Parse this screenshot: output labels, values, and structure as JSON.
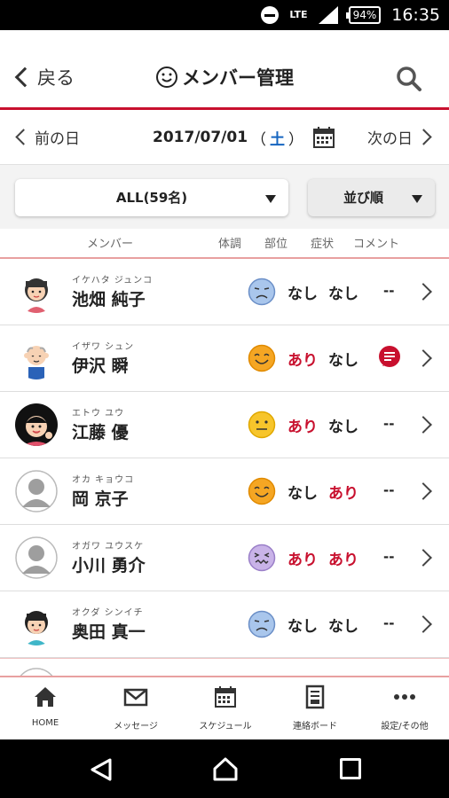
{
  "status_bar": {
    "network": "LTE",
    "battery": "94%",
    "time": "16:35"
  },
  "header": {
    "back_label": "戻る",
    "title": "メンバー管理",
    "title_icon": "smiley-icon",
    "search_icon": "search-icon"
  },
  "date_nav": {
    "prev_label": "前の日",
    "date": "2017/07/01",
    "open_paren": "（",
    "day_of_week": "土",
    "close_paren": "）",
    "next_label": "次の日"
  },
  "filters": {
    "group_selected": "ALL(59名)",
    "sort_label": "並び順"
  },
  "columns": {
    "member": "メンバー",
    "condition": "体調",
    "body_part": "部位",
    "symptom": "症状",
    "comment": "コメント"
  },
  "members": [
    {
      "kana": "イケハタ ジュンコ",
      "name": "池畑 純子",
      "condition_face": "sad-face",
      "body_part": "なし",
      "symptom": "なし",
      "comment": "--"
    },
    {
      "kana": "イザワ シュン",
      "name": "伊沢 瞬",
      "condition_face": "happy-face",
      "body_part": "あり",
      "symptom": "なし",
      "comment": "chat-icon"
    },
    {
      "kana": "エトウ ユウ",
      "name": "江藤 優",
      "condition_face": "neutral-face",
      "body_part": "あり",
      "symptom": "なし",
      "comment": "--"
    },
    {
      "kana": "オカ キョウコ",
      "name": "岡 京子",
      "condition_face": "happy-face",
      "body_part": "なし",
      "symptom": "あり",
      "comment": "--"
    },
    {
      "kana": "オガワ ユウスケ",
      "name": "小川 勇介",
      "condition_face": "sick-face",
      "body_part": "あり",
      "symptom": "あり",
      "comment": "--"
    },
    {
      "kana": "オクダ シンイチ",
      "name": "奥田 真一",
      "condition_face": "sad-face",
      "body_part": "なし",
      "symptom": "なし",
      "comment": "--"
    }
  ],
  "tabs": {
    "home": "HOME",
    "messages": "メッセージ",
    "schedule": "スケジュール",
    "board": "連絡ボード",
    "settings": "設定/その他"
  },
  "colors": {
    "accent_red": "#c8102e",
    "weekday_blue": "#1565c0"
  }
}
